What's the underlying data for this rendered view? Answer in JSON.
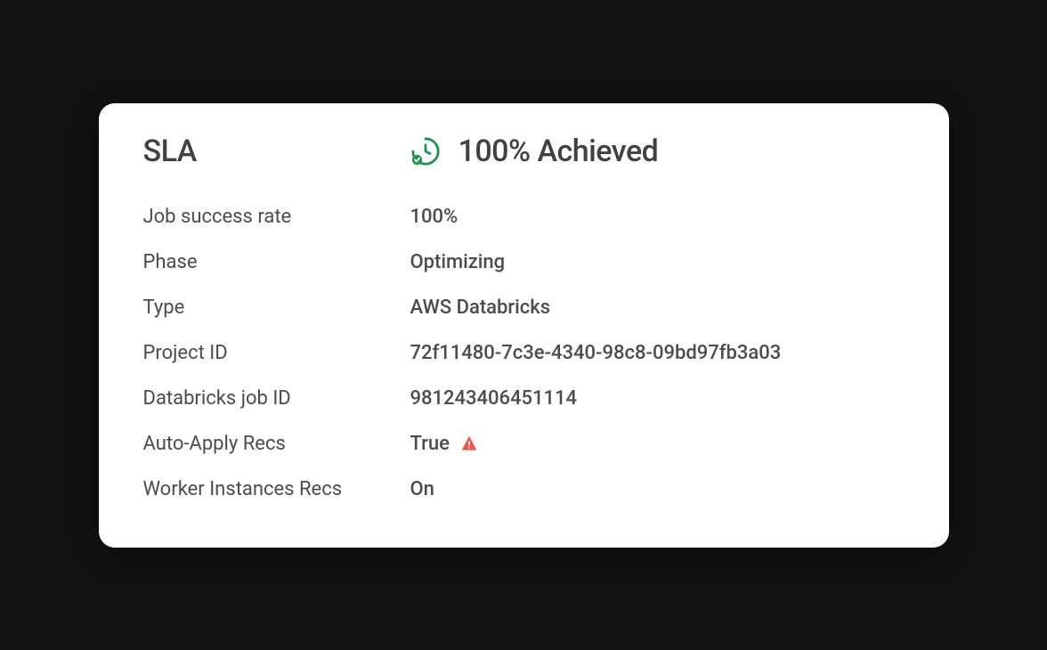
{
  "card": {
    "title": "SLA",
    "achieved": "100% Achieved",
    "rows": [
      {
        "label": "Job success rate",
        "value": "100%"
      },
      {
        "label": "Phase",
        "value": "Optimizing"
      },
      {
        "label": "Type",
        "value": "AWS Databricks"
      },
      {
        "label": "Project ID",
        "value": "72f11480-7c3e-4340-98c8-09bd97fb3a03"
      },
      {
        "label": "Databricks job ID",
        "value": "981243406451114"
      },
      {
        "label": "Auto-Apply Recs",
        "value": "True",
        "warn": true
      },
      {
        "label": "Worker Instances Recs",
        "value": "On"
      }
    ],
    "colors": {
      "icon_green": "#1f9254",
      "warn_red": "#f1554a"
    }
  }
}
